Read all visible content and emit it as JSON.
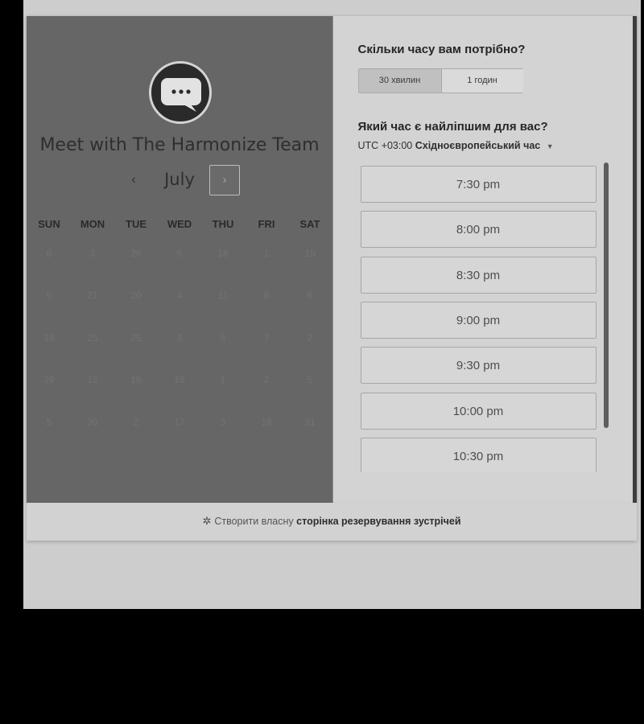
{
  "left": {
    "team_title": "Meet with The Harmonize Team",
    "month": "July",
    "prev_icon": "‹",
    "next_icon": "›",
    "weekdays": [
      "SUN",
      "MON",
      "TUE",
      "WED",
      "THU",
      "FRI",
      "SAT"
    ],
    "days": [
      [
        "6",
        "3",
        "26",
        "5",
        "18",
        "1",
        "15"
      ],
      [
        "5",
        "21",
        "20",
        "4",
        "11",
        "8",
        "6"
      ],
      [
        "18",
        "25",
        "25",
        "3",
        "5",
        "7",
        "2"
      ],
      [
        "29",
        "12",
        "16",
        "16",
        "1",
        "2",
        "5"
      ],
      [
        "5",
        "20",
        "2",
        "17",
        "3",
        "18",
        "31"
      ]
    ],
    "avatar_icon": "chat-bubble-icon"
  },
  "right": {
    "duration_title": "Скільки часу вам потрібно?",
    "durations": [
      "30 хвилин",
      "1 годин"
    ],
    "selected_duration": "30 хвилин",
    "time_title": "Який час є найліпшим для вас?",
    "tz_prefix": "UTC +03:00",
    "tz_name": "Східноєвропейський час",
    "tz_caret_icon": "caret-down-icon",
    "slots": [
      "7:30 pm",
      "8:00 pm",
      "8:30 pm",
      "9:00 pm",
      "9:30 pm",
      "10:00 pm",
      "10:30 pm"
    ]
  },
  "footer": {
    "icon": "hubspot-sprocket-icon",
    "text_normal": "Створити власну",
    "text_bold": "сторінка резервування зустрічей"
  },
  "colors": {
    "left_panel": "#666666",
    "right_panel": "#d3d3d3",
    "page_background": "#cdcdcd"
  }
}
